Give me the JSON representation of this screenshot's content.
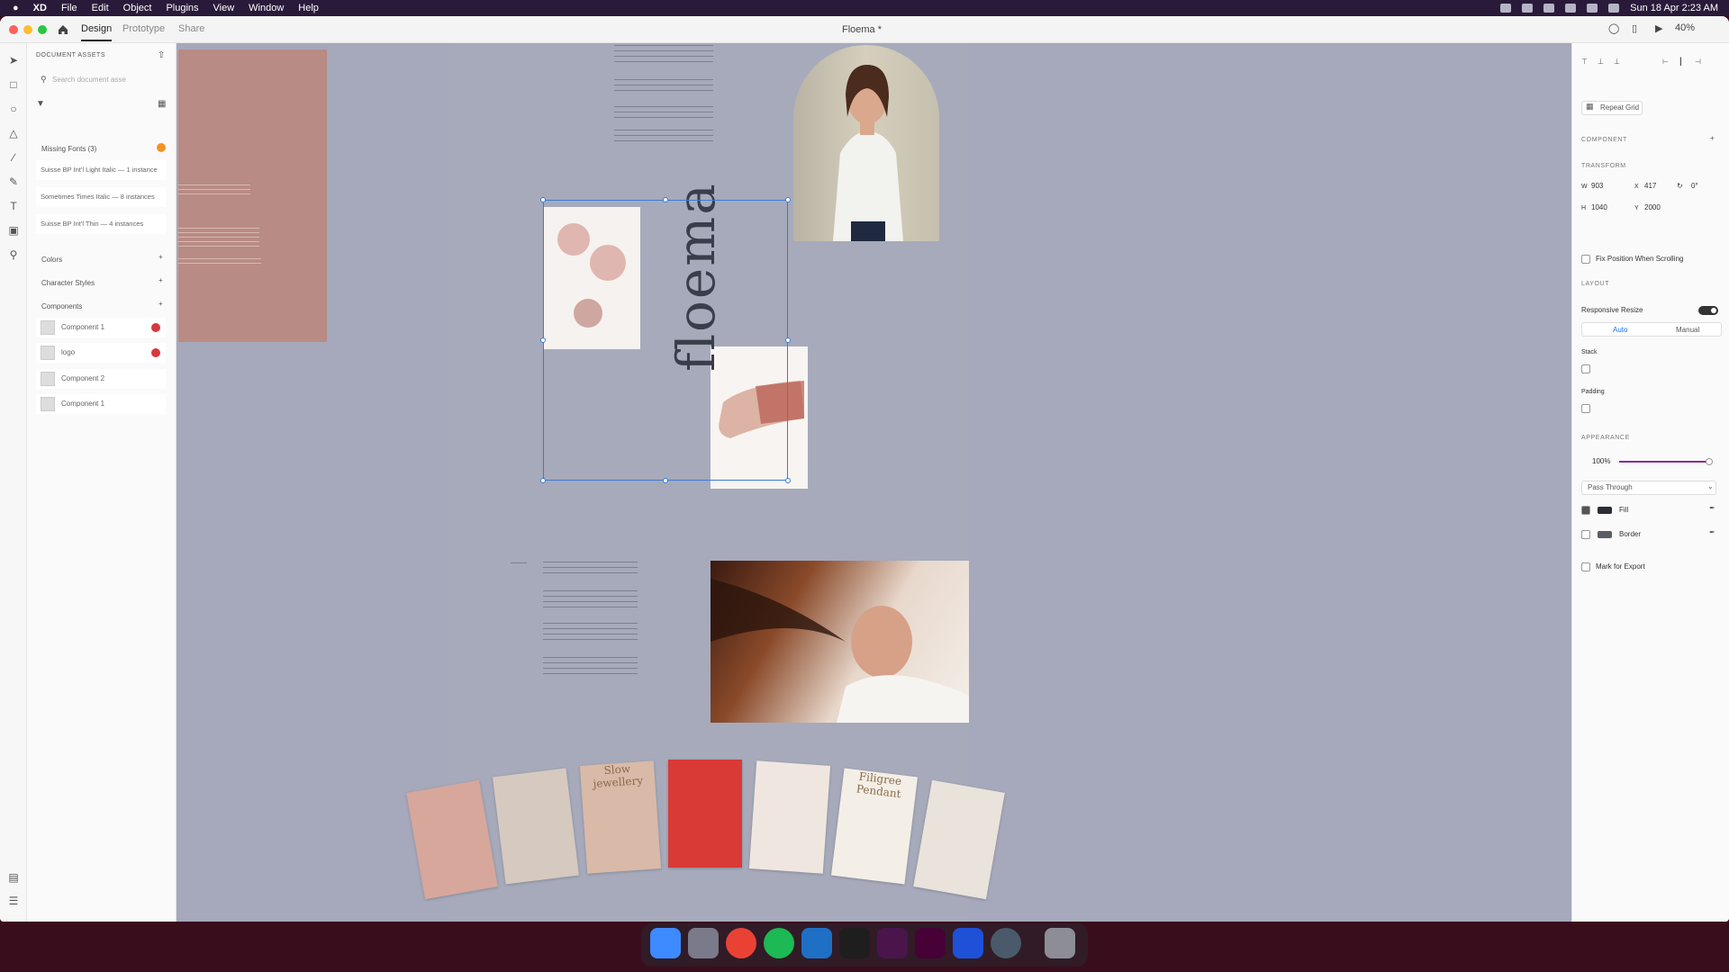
{
  "menubar": {
    "apple": "",
    "app": "XD",
    "items": [
      "File",
      "Edit",
      "Object",
      "Plugins",
      "View",
      "Window",
      "Help"
    ],
    "clock": "Sun 18 Apr  2:23 AM"
  },
  "window": {
    "tabs": [
      "Design",
      "Prototype",
      "Share"
    ],
    "active_tab": "Design",
    "title": "Floema *",
    "zoom": "40%"
  },
  "assets": {
    "header": "DOCUMENT ASSETS",
    "search_placeholder": "Search document asse",
    "missing_fonts_label": "Missing Fonts (3)",
    "missing_fonts": [
      "Suisse BP Int'l Light Italic — 1 instance",
      "Sometimes Times Italic — 8 instances",
      "Suisse BP Int'l Thin — 4 instances"
    ],
    "colors_label": "Colors",
    "char_styles_label": "Character Styles",
    "components_label": "Components",
    "components": [
      {
        "name": "Component 1",
        "warning": true
      },
      {
        "name": "logo",
        "warning": true
      },
      {
        "name": "Component 2",
        "warning": false
      },
      {
        "name": "Component 1",
        "warning": false
      }
    ]
  },
  "canvas": {
    "brand_text": "floema",
    "cards": [
      "",
      "",
      "Slow jewellery",
      "",
      "",
      "Filigree Pendant",
      ""
    ]
  },
  "props": {
    "repeat_grid": "Repeat Grid",
    "component_label": "COMPONENT",
    "transform_label": "TRANSFORM",
    "w_label": "W",
    "w": "903",
    "x_label": "X",
    "x": "417",
    "rotation": "0°",
    "h_label": "H",
    "h": "1040",
    "y_label": "Y",
    "y": "2000",
    "fix_position": "Fix Position When Scrolling",
    "layout_label": "LAYOUT",
    "responsive_resize": "Responsive Resize",
    "auto": "Auto",
    "manual": "Manual",
    "stack": "Stack",
    "padding": "Padding",
    "appearance_label": "APPEARANCE",
    "opacity": "100%",
    "blend_mode": "Pass Through",
    "fill": "Fill",
    "border": "Border",
    "mark_export": "Mark for Export"
  },
  "colors": {
    "accent": "#3a7bd5",
    "warning": "#d7373f",
    "opacity_slider": "#8e2a96",
    "fill_swatch": "#2b2d38",
    "border_swatch": "#5b5d66"
  }
}
